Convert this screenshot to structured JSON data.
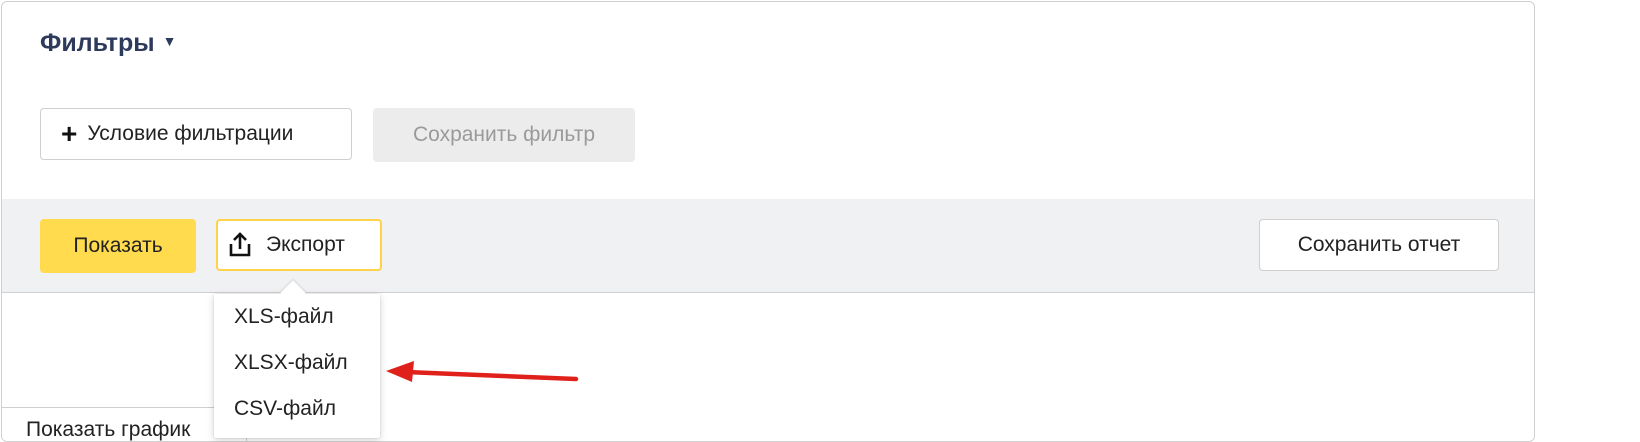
{
  "filters": {
    "title": "Фильтры",
    "caret": "▼",
    "add_condition_icon": "+",
    "add_condition_label": "Условие фильтрации",
    "save_filter_label": "Сохранить фильтр"
  },
  "actions": {
    "show_label": "Показать",
    "export_label": "Экспорт",
    "export_icon": "upload-icon",
    "save_report_label": "Сохранить отчет"
  },
  "export_menu": {
    "items": [
      {
        "label": "XLS-файл"
      },
      {
        "label": "XLSX-файл"
      },
      {
        "label": "CSV-файл"
      }
    ]
  },
  "chart_tab": {
    "label": "Показать график"
  },
  "colors": {
    "accent_yellow": "#ffdb4d",
    "export_border": "#ffd24a",
    "title_color": "#2e3a5c",
    "action_bar_bg": "#f0f1f3",
    "annotation_arrow": "#e0201a"
  }
}
